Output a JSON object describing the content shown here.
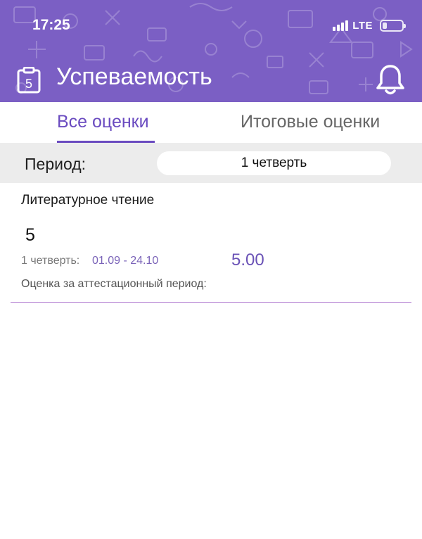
{
  "status_bar": {
    "time": "17:25",
    "network": "LTE"
  },
  "header": {
    "title": "Успеваемость",
    "app_icon_digit": "5",
    "colors": {
      "background": "#7b5fc4",
      "text": "#ffffff"
    }
  },
  "tabs": [
    {
      "label": "Все оценки",
      "active": true
    },
    {
      "label": "Итоговые оценки",
      "active": false
    }
  ],
  "filter": {
    "label": "Период:",
    "selected": "1 четверть"
  },
  "grades": [
    {
      "subject": "Литературное чтение",
      "marks": "5",
      "period_name": "1 четверть:",
      "period_dates": "01.09 - 24.10",
      "average": "5.00",
      "attestation_label": "Оценка за аттестационный период:"
    }
  ],
  "colors": {
    "accent": "#6a4bc0",
    "divider": "#b07ad0"
  }
}
